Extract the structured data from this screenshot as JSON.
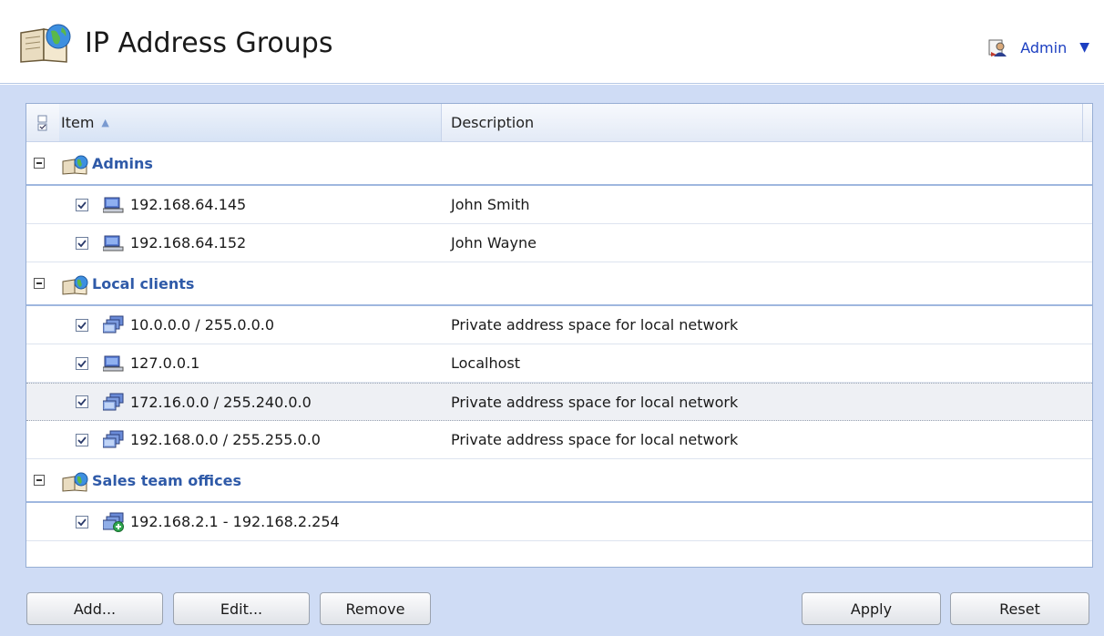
{
  "header": {
    "title": "IP Address Groups",
    "user": "Admin",
    "user_caret": "▼"
  },
  "grid": {
    "columns": {
      "item": "Item",
      "description": "Description"
    },
    "sort": "ascending",
    "groups": [
      {
        "name": "Admins",
        "items": [
          {
            "address": "192.168.64.145",
            "description": "John Smith",
            "icon": "host-icon",
            "checked": true
          },
          {
            "address": "192.168.64.152",
            "description": "John Wayne",
            "icon": "host-icon",
            "checked": true
          }
        ]
      },
      {
        "name": "Local clients",
        "items": [
          {
            "address": "10.0.0.0 / 255.0.0.0",
            "description": "Private address space for local network",
            "icon": "network-icon",
            "checked": true
          },
          {
            "address": "127.0.0.1",
            "description": "Localhost",
            "icon": "host-icon",
            "checked": true
          },
          {
            "address": "172.16.0.0 / 255.240.0.0",
            "description": "Private address space for local network",
            "icon": "network-icon",
            "checked": true,
            "selected": true
          },
          {
            "address": "192.168.0.0 / 255.255.0.0",
            "description": "Private address space for local network",
            "icon": "network-icon",
            "checked": true
          }
        ]
      },
      {
        "name": "Sales team offices",
        "items": [
          {
            "address": "192.168.2.1 - 192.168.2.254",
            "description": "",
            "icon": "range-icon",
            "checked": true
          }
        ]
      }
    ]
  },
  "buttons": {
    "add": "Add...",
    "edit": "Edit...",
    "remove": "Remove",
    "apply": "Apply",
    "reset": "Reset"
  },
  "colors": {
    "main_bg": "#cfdcf5",
    "group_label": "#2f5aa8",
    "link": "#1c3fc1"
  }
}
